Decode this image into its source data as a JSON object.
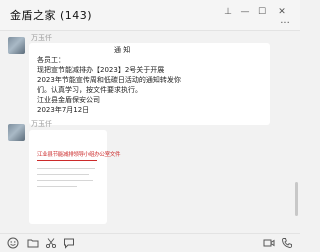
{
  "window": {
    "title": "金盾之家 (143)",
    "buttons": {
      "pin": "⊥",
      "minimize": "—",
      "maximize": "☐",
      "close": "✕",
      "more": "···"
    }
  },
  "messages": [
    {
      "sender": "万玉仟",
      "type": "text",
      "lines": [
        "通    知",
        "各员工：",
        "    现把宣节能减排办【2023】2号关于开展",
        "2023年节能宣传周和低碳日活动的通知转发你",
        "们。认真学习，按文件要求执行。",
        "    江业县金盾保安公司",
        "        2023年7月12日"
      ]
    },
    {
      "sender": "万玉仟",
      "type": "image",
      "doc_title": "江业县节能减排领导小组办公室文件"
    }
  ],
  "toolbar": {
    "icons": [
      "emoji-icon",
      "folder-icon",
      "scissors-icon",
      "chat-bubble-icon",
      "video-icon",
      "phone-icon"
    ]
  },
  "colors": {
    "accent_red": "#cc2a2a",
    "bubble": "#ffffff",
    "background": "#f2f2f2"
  }
}
